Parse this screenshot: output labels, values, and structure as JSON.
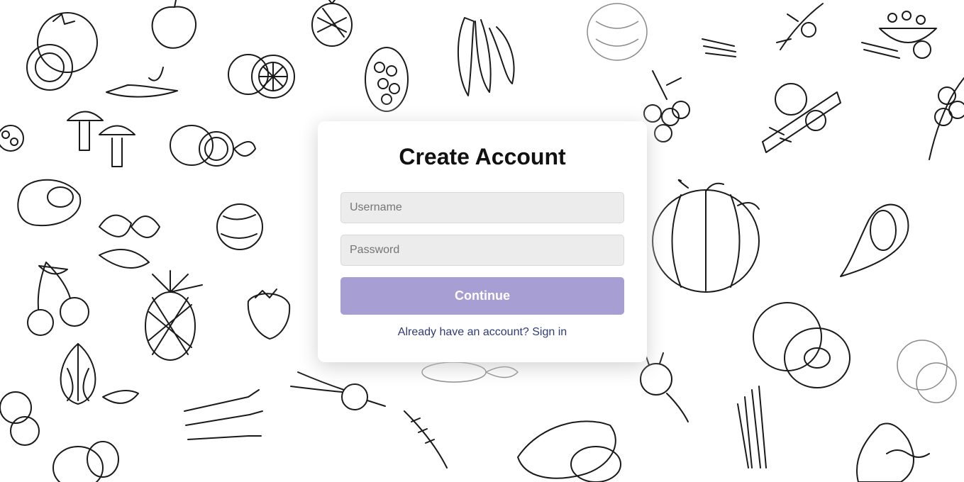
{
  "form": {
    "title": "Create Account",
    "username_placeholder": "Username",
    "password_placeholder": "Password",
    "continue_label": "Continue",
    "signin_link": "Already have an account? Sign in"
  },
  "colors": {
    "button": "#a79ed4",
    "link": "#2f3a7a",
    "field_bg": "#ececec"
  },
  "background": {
    "illustration_icons": [
      "tomato-icon",
      "apple-icon",
      "pineapple-icon",
      "raspberry-icon",
      "banana-icon",
      "artichoke-icon",
      "carrots-icon",
      "berry-branch-icon",
      "salad-bowl-icon",
      "chili-pepper-icon",
      "orange-icon",
      "blackberry-icon",
      "mushrooms-icon",
      "lemon-icon",
      "berries-branch-icon",
      "vegetables-board-icon",
      "apricot-branch-icon",
      "avocado-icon",
      "strawberries-icon",
      "coconut-icon",
      "pumpkin-icon",
      "fig-icon",
      "cherries-icon",
      "strawberry-icon",
      "kiwi-icon",
      "garlic-icon",
      "radish-icon",
      "corn-icon",
      "beet-icon",
      "asparagus-icon",
      "onion-icon",
      "potato-icon",
      "wheat-icon",
      "sweet-potato-icon"
    ]
  }
}
